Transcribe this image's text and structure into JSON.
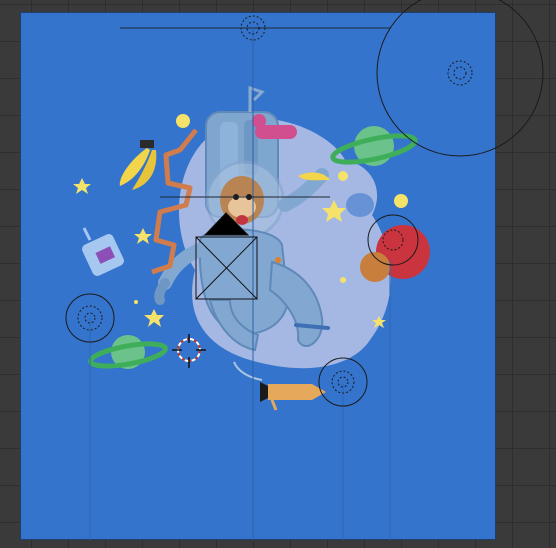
{
  "viewport": {
    "mode": "camera-view",
    "scene": "space-monkey-astronaut",
    "colors": {
      "background": "#3a3a3a",
      "grid": "#2e2e2e",
      "frame": "#3574cc",
      "moon": "#b9c6e6",
      "astronaut": "#7fa6cf",
      "overlay_line": "#111111"
    }
  },
  "objects": [
    {
      "name": "monkey-astronaut",
      "type": "mesh"
    },
    {
      "name": "moon-backdrop",
      "type": "mesh"
    },
    {
      "name": "planet-green-right",
      "type": "mesh"
    },
    {
      "name": "planet-green-left",
      "type": "mesh"
    },
    {
      "name": "planet-red",
      "type": "mesh"
    },
    {
      "name": "planet-orange",
      "type": "mesh"
    },
    {
      "name": "rocket",
      "type": "mesh"
    },
    {
      "name": "walkie-talkie",
      "type": "mesh"
    },
    {
      "name": "bananas",
      "type": "mesh"
    },
    {
      "name": "light-area",
      "type": "light"
    },
    {
      "name": "light-point",
      "type": "light"
    },
    {
      "name": "camera-object",
      "type": "camera"
    }
  ],
  "icons": {
    "light": "sun-light-icon",
    "camera": "camera-icon",
    "cursor": "3d-cursor-icon"
  }
}
